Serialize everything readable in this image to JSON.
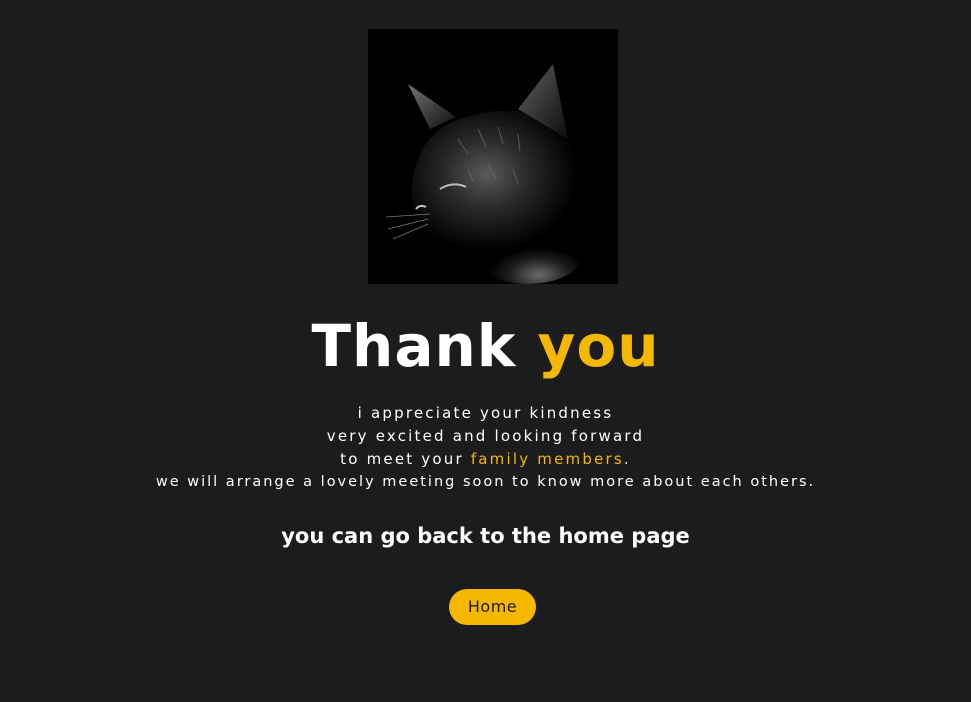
{
  "image": {
    "subject": "cat-photo"
  },
  "title": {
    "word1": "Thank",
    "word2": "you"
  },
  "message": {
    "line1": "i appreciate your kindness",
    "line2": "very excited and looking forward",
    "line3_before": "to meet your ",
    "line3_highlight": "family members",
    "line3_after": ".",
    "line4": "we will arrange a lovely meeting soon to know more about each others."
  },
  "back_text": "you can go back to the home page",
  "home_button": {
    "label": "Home"
  },
  "colors": {
    "background": "#1c1c1e",
    "accent": "#f5b800",
    "text": "#ffffff"
  }
}
